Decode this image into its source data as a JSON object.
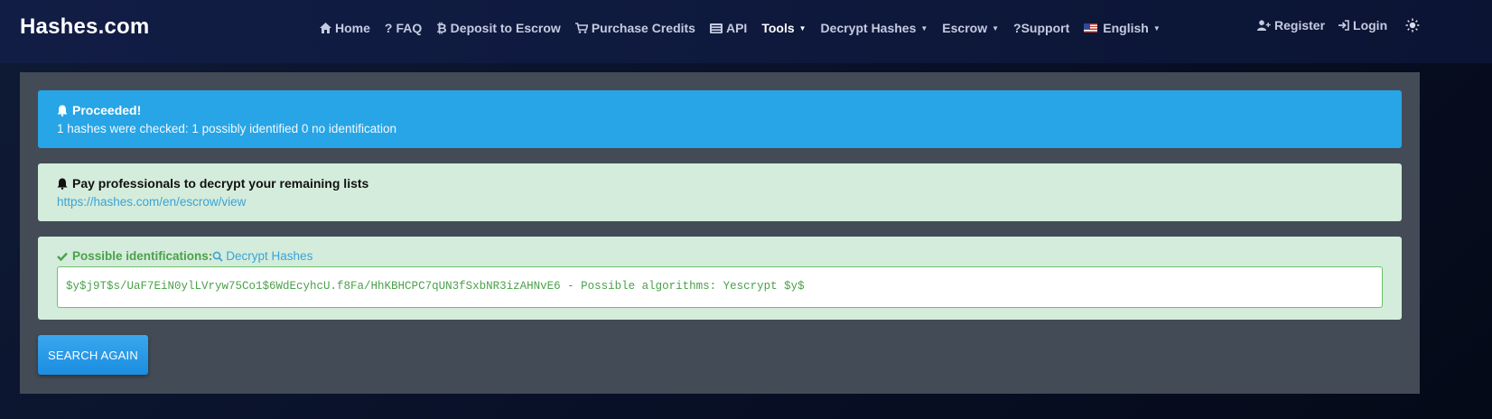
{
  "brand": "Hashes.com",
  "nav": {
    "home": "Home",
    "faq": "FAQ",
    "deposit": "Deposit to Escrow",
    "credits": "Purchase Credits",
    "api": "API",
    "tools": "Tools",
    "decrypt": "Decrypt Hashes",
    "escrow": "Escrow",
    "support": "?Support",
    "language": "English",
    "register": "Register",
    "login": "Login"
  },
  "alerts": {
    "info_title": "Proceeded!",
    "info_text": "1 hashes were checked: 1 possibly identified 0 no identification",
    "escrow_title": "Pay professionals to decrypt your remaining lists",
    "escrow_link": "https://hashes.com/en/escrow/view",
    "result_label": "Possible identifications:",
    "result_link": "Decrypt Hashes",
    "result_value": "$y$j9T$s/UaF7EiN0ylLVryw75Co1$6WdEcyhcU.f8Fa/HhKBHCPC7qUN3fSxbNR3izAHNvE6 - Possible algorithms: Yescrypt $y$"
  },
  "button": {
    "search_again": "SEARCH AGAIN"
  },
  "colors": {
    "info": "#27a5e6",
    "success_bg": "#d4ecdb",
    "success_text": "#4aa14a",
    "panel": "#434b56"
  }
}
